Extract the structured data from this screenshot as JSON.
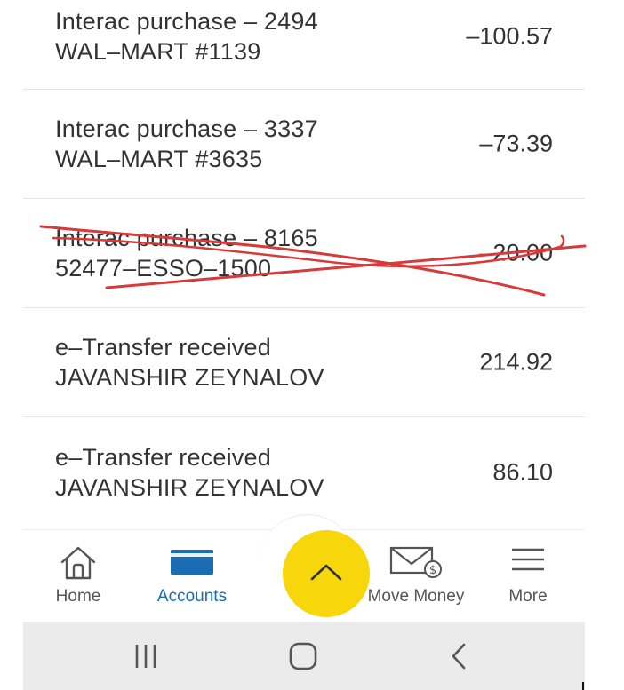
{
  "transactions": [
    {
      "title": "Interac purchase – 2494",
      "merchant": "WAL–MART #1139",
      "amount": "–100.57",
      "crossed_out": false
    },
    {
      "title": "Interac purchase – 3337",
      "merchant": "WAL–MART #3635",
      "amount": "–73.39",
      "crossed_out": false
    },
    {
      "title": "Interac purchase – 8165",
      "merchant": "52477–ESSO–1500",
      "amount": "–20.00",
      "crossed_out": true
    },
    {
      "title": "e–Transfer received",
      "merchant": "JAVANSHIR ZEYNALOV",
      "amount": "214.92",
      "crossed_out": false
    },
    {
      "title": "e–Transfer received",
      "merchant": "JAVANSHIR ZEYNALOV",
      "amount": "86.10",
      "crossed_out": false
    }
  ],
  "bottom_nav": {
    "home": {
      "label": "Home",
      "icon": "home-icon"
    },
    "accounts": {
      "label": "Accounts",
      "icon": "card-icon",
      "active": true
    },
    "quick_action": {
      "icon": "chevron-up-icon"
    },
    "move_money": {
      "label": "Move Money",
      "icon": "envelope-dollar-icon"
    },
    "more": {
      "label": "More",
      "icon": "hamburger-menu-icon"
    }
  },
  "colors": {
    "accent": "#1a6cb3",
    "fab": "#f7d70c",
    "scribble": "#d63a3a",
    "system_bar": "#ebebeb"
  },
  "system_nav": {
    "recents": "recents-icon",
    "home": "home-button-icon",
    "back": "back-icon"
  }
}
